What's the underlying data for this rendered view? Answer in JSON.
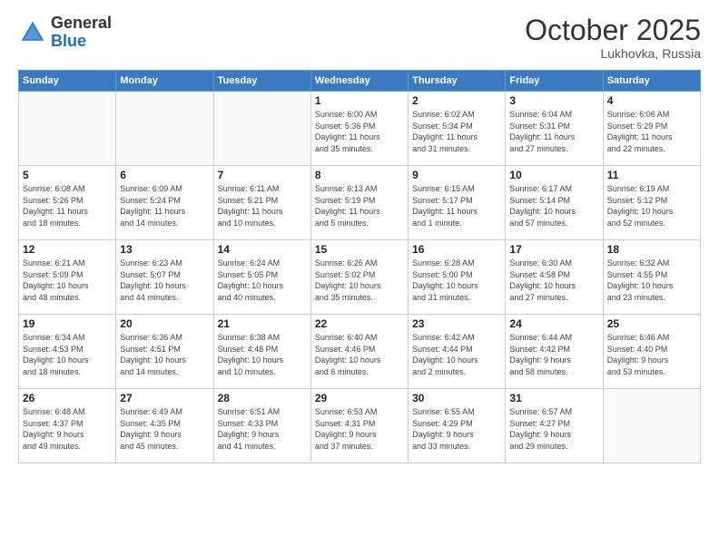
{
  "header": {
    "logo_general": "General",
    "logo_blue": "Blue",
    "month": "October 2025",
    "location": "Lukhovka, Russia"
  },
  "weekdays": [
    "Sunday",
    "Monday",
    "Tuesday",
    "Wednesday",
    "Thursday",
    "Friday",
    "Saturday"
  ],
  "weeks": [
    [
      {
        "day": "",
        "info": ""
      },
      {
        "day": "",
        "info": ""
      },
      {
        "day": "",
        "info": ""
      },
      {
        "day": "1",
        "info": "Sunrise: 6:00 AM\nSunset: 5:36 PM\nDaylight: 11 hours\nand 35 minutes."
      },
      {
        "day": "2",
        "info": "Sunrise: 6:02 AM\nSunset: 5:34 PM\nDaylight: 11 hours\nand 31 minutes."
      },
      {
        "day": "3",
        "info": "Sunrise: 6:04 AM\nSunset: 5:31 PM\nDaylight: 11 hours\nand 27 minutes."
      },
      {
        "day": "4",
        "info": "Sunrise: 6:06 AM\nSunset: 5:29 PM\nDaylight: 11 hours\nand 22 minutes."
      }
    ],
    [
      {
        "day": "5",
        "info": "Sunrise: 6:08 AM\nSunset: 5:26 PM\nDaylight: 11 hours\nand 18 minutes."
      },
      {
        "day": "6",
        "info": "Sunrise: 6:09 AM\nSunset: 5:24 PM\nDaylight: 11 hours\nand 14 minutes."
      },
      {
        "day": "7",
        "info": "Sunrise: 6:11 AM\nSunset: 5:21 PM\nDaylight: 11 hours\nand 10 minutes."
      },
      {
        "day": "8",
        "info": "Sunrise: 6:13 AM\nSunset: 5:19 PM\nDaylight: 11 hours\nand 5 minutes."
      },
      {
        "day": "9",
        "info": "Sunrise: 6:15 AM\nSunset: 5:17 PM\nDaylight: 11 hours\nand 1 minute."
      },
      {
        "day": "10",
        "info": "Sunrise: 6:17 AM\nSunset: 5:14 PM\nDaylight: 10 hours\nand 57 minutes."
      },
      {
        "day": "11",
        "info": "Sunrise: 6:19 AM\nSunset: 5:12 PM\nDaylight: 10 hours\nand 52 minutes."
      }
    ],
    [
      {
        "day": "12",
        "info": "Sunrise: 6:21 AM\nSunset: 5:09 PM\nDaylight: 10 hours\nand 48 minutes."
      },
      {
        "day": "13",
        "info": "Sunrise: 6:23 AM\nSunset: 5:07 PM\nDaylight: 10 hours\nand 44 minutes."
      },
      {
        "day": "14",
        "info": "Sunrise: 6:24 AM\nSunset: 5:05 PM\nDaylight: 10 hours\nand 40 minutes."
      },
      {
        "day": "15",
        "info": "Sunrise: 6:26 AM\nSunset: 5:02 PM\nDaylight: 10 hours\nand 35 minutes."
      },
      {
        "day": "16",
        "info": "Sunrise: 6:28 AM\nSunset: 5:00 PM\nDaylight: 10 hours\nand 31 minutes."
      },
      {
        "day": "17",
        "info": "Sunrise: 6:30 AM\nSunset: 4:58 PM\nDaylight: 10 hours\nand 27 minutes."
      },
      {
        "day": "18",
        "info": "Sunrise: 6:32 AM\nSunset: 4:55 PM\nDaylight: 10 hours\nand 23 minutes."
      }
    ],
    [
      {
        "day": "19",
        "info": "Sunrise: 6:34 AM\nSunset: 4:53 PM\nDaylight: 10 hours\nand 18 minutes."
      },
      {
        "day": "20",
        "info": "Sunrise: 6:36 AM\nSunset: 4:51 PM\nDaylight: 10 hours\nand 14 minutes."
      },
      {
        "day": "21",
        "info": "Sunrise: 6:38 AM\nSunset: 4:48 PM\nDaylight: 10 hours\nand 10 minutes."
      },
      {
        "day": "22",
        "info": "Sunrise: 6:40 AM\nSunset: 4:46 PM\nDaylight: 10 hours\nand 6 minutes."
      },
      {
        "day": "23",
        "info": "Sunrise: 6:42 AM\nSunset: 4:44 PM\nDaylight: 10 hours\nand 2 minutes."
      },
      {
        "day": "24",
        "info": "Sunrise: 6:44 AM\nSunset: 4:42 PM\nDaylight: 9 hours\nand 58 minutes."
      },
      {
        "day": "25",
        "info": "Sunrise: 6:46 AM\nSunset: 4:40 PM\nDaylight: 9 hours\nand 53 minutes."
      }
    ],
    [
      {
        "day": "26",
        "info": "Sunrise: 6:48 AM\nSunset: 4:37 PM\nDaylight: 9 hours\nand 49 minutes."
      },
      {
        "day": "27",
        "info": "Sunrise: 6:49 AM\nSunset: 4:35 PM\nDaylight: 9 hours\nand 45 minutes."
      },
      {
        "day": "28",
        "info": "Sunrise: 6:51 AM\nSunset: 4:33 PM\nDaylight: 9 hours\nand 41 minutes."
      },
      {
        "day": "29",
        "info": "Sunrise: 6:53 AM\nSunset: 4:31 PM\nDaylight: 9 hours\nand 37 minutes."
      },
      {
        "day": "30",
        "info": "Sunrise: 6:55 AM\nSunset: 4:29 PM\nDaylight: 9 hours\nand 33 minutes."
      },
      {
        "day": "31",
        "info": "Sunrise: 6:57 AM\nSunset: 4:27 PM\nDaylight: 9 hours\nand 29 minutes."
      },
      {
        "day": "",
        "info": ""
      }
    ]
  ]
}
